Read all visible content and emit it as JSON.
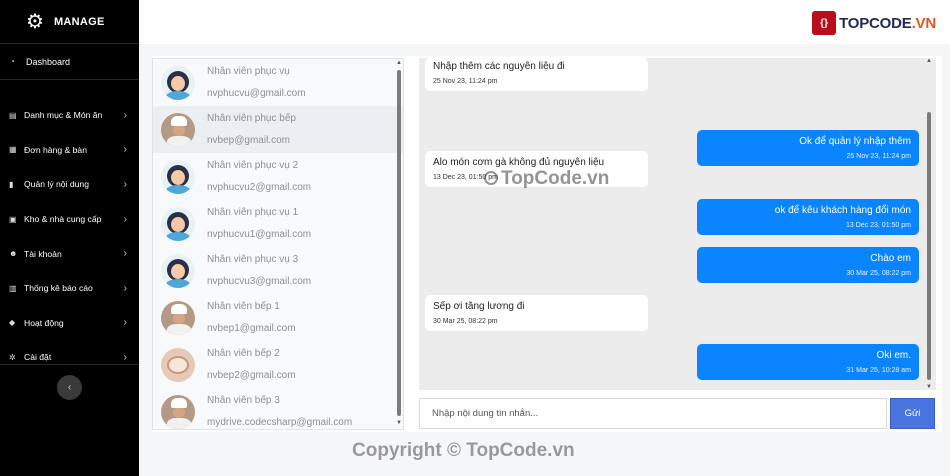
{
  "sidebar": {
    "brand": "MANAGE",
    "dashboard": "Dashboard",
    "items": [
      {
        "label": "Danh mục & Món ăn",
        "icon": "list-icon"
      },
      {
        "label": "Đơn hàng & bàn",
        "icon": "cart-icon"
      },
      {
        "label": "Quản lý nội dung",
        "icon": "file-icon"
      },
      {
        "label": "Kho & nhà cung cấp",
        "icon": "box-icon"
      },
      {
        "label": "Tài khoản",
        "icon": "users-icon"
      },
      {
        "label": "Thống kê báo cáo",
        "icon": "chart-icon"
      },
      {
        "label": "Hoạt động",
        "icon": "activity-icon"
      },
      {
        "label": "Cài đặt",
        "icon": "gear-icon"
      }
    ]
  },
  "topbar": {
    "logo_badge": "{}",
    "logo_text": "TOPCODE",
    "logo_suffix": ".VN"
  },
  "contacts": [
    {
      "name": "Nhân viên phục vụ",
      "email": "nvphucvu@gmail.com",
      "avatar": "waiter",
      "active": false
    },
    {
      "name": "Nhân viên phục bếp",
      "email": "nvbep@gmail.com",
      "avatar": "chef",
      "active": true
    },
    {
      "name": "Nhân viên phục vụ 2",
      "email": "nvphucvu2@gmail.com",
      "avatar": "waiter",
      "active": false
    },
    {
      "name": "Nhân viên phục vụ 1",
      "email": "nvphucvu1@gmail.com",
      "avatar": "waiter",
      "active": false
    },
    {
      "name": "Nhân viên phục vụ 3",
      "email": "nvphucvu3@gmail.com",
      "avatar": "waiter",
      "active": false
    },
    {
      "name": "Nhân viên bếp 1",
      "email": "nvbep1@gmail.com",
      "avatar": "chef",
      "active": false
    },
    {
      "name": "Nhân viên bếp 2",
      "email": "nvbep2@gmail.com",
      "avatar": "food",
      "active": false
    },
    {
      "name": "Nhân viên bếp 3",
      "email": "mydrive.codecsharp@gmail.com",
      "avatar": "chef",
      "active": false
    }
  ],
  "messages": [
    {
      "dir": "in",
      "text": "Nhập thêm các nguyên liệu đi",
      "time": "25 Nov 23, 11:24 pm"
    },
    {
      "dir": "out",
      "text": "Ok để quản lý nhập thêm",
      "time": "25 Nov 23, 11:24 pm"
    },
    {
      "dir": "in",
      "text": "Alo món cơm gà không đủ nguyên liệu",
      "time": "13 Dec 23, 01:50 pm"
    },
    {
      "dir": "out",
      "text": "ok để kêu khách hàng đổi món",
      "time": "13 Dec 23, 01:50 pm"
    },
    {
      "dir": "out",
      "text": "Chào em",
      "time": "30 Mar 25, 08:22 pm"
    },
    {
      "dir": "in",
      "text": "Sếp ơi tăng lương đi",
      "time": "30 Mar 25, 08:22 pm"
    },
    {
      "dir": "out",
      "text": "Oki em.",
      "time": "31 Mar 25, 10:28 am"
    }
  ],
  "composer": {
    "placeholder": "Nhập nội dung tin nhắn...",
    "value": "",
    "send_label": "Gửi"
  },
  "watermarks": {
    "center": "TopCode.vn",
    "bottom": "Copyright © TopCode.vn"
  }
}
